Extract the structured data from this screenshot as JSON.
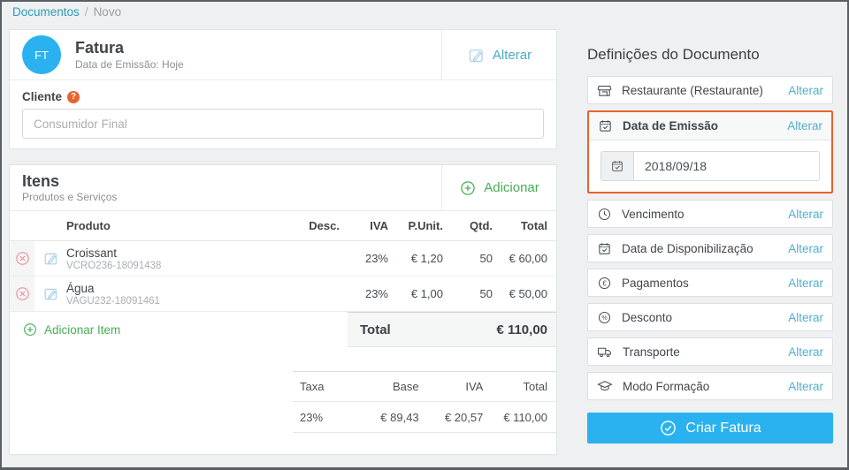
{
  "breadcrumb": {
    "link": "Documentos",
    "separator": "/",
    "current": "Novo"
  },
  "invoice_card": {
    "badge": "FT",
    "title": "Fatura",
    "subtitle": "Data de Emissão: Hoje",
    "change_label": "Alterar",
    "change_icon": "pencil-square-icon",
    "client_label": "Cliente",
    "client_help_glyph": "?",
    "client_help_icon": "question-circle-icon",
    "client_placeholder": "Consumidor Final",
    "client_value": ""
  },
  "items_card": {
    "title": "Itens",
    "subtitle": "Produtos e Serviços",
    "add_label": "Adicionar",
    "add_icon": "plus-circle-icon",
    "columns": [
      "Produto",
      "Desc.",
      "IVA",
      "P.Unit.",
      "Qtd.",
      "Total"
    ],
    "rows": [
      {
        "delete_icon": "x-circle-icon",
        "edit_icon": "pencil-square-icon",
        "name": "Croissant",
        "code": "VCRO236-18091438",
        "desc": "",
        "iva": "23%",
        "punit": "€ 1,20",
        "qtd": "50",
        "total": "€ 60,00"
      },
      {
        "delete_icon": "x-circle-icon",
        "edit_icon": "pencil-square-icon",
        "name": "Água",
        "code": "VAGU232-18091461",
        "desc": "",
        "iva": "23%",
        "punit": "€ 1,00",
        "qtd": "50",
        "total": "€ 50,00"
      }
    ],
    "footer": {
      "add_item_label": "Adicionar Item",
      "add_item_icon": "plus-circle-icon",
      "total_label": "Total",
      "total_value": "€ 110,00"
    },
    "tax_table": {
      "columns": [
        "Taxa",
        "Base",
        "IVA",
        "Total"
      ],
      "rows": [
        [
          "23%",
          "€ 89,43",
          "€ 20,57",
          "€ 110,00"
        ]
      ]
    }
  },
  "settings_panel": {
    "title": "Definições do Documento",
    "change_label": "Alterar",
    "rows": [
      {
        "icon": "storefront-icon",
        "label": "Restaurante (Restaurante)"
      },
      {
        "icon": "calendar-check-icon",
        "label": "Data de Emissão",
        "highlighted": true,
        "input_value": "2018/09/18",
        "input_icon": "calendar-check-icon"
      },
      {
        "icon": "clock-icon",
        "label": "Vencimento"
      },
      {
        "icon": "calendar-check-icon",
        "label": "Data de Disponibilização"
      },
      {
        "icon": "euro-circle-icon",
        "label": "Pagamentos"
      },
      {
        "icon": "percent-circle-icon",
        "label": "Desconto"
      },
      {
        "icon": "truck-icon",
        "label": "Transporte"
      },
      {
        "icon": "graduation-cap-icon",
        "label": "Modo Formação"
      }
    ],
    "submit_label": "Criar Fatura",
    "submit_icon": "check-circle-icon"
  },
  "colors": {
    "accent_blue": "#29b2ef",
    "breadcrumb_link_teal": "#2d9cb8",
    "alterar_link_blue": "#52aecd",
    "action_green": "#46ad54",
    "highlight_orange": "#e8632d",
    "delete_red": "#e8909a",
    "edit_light_blue": "#a9cfe8"
  }
}
